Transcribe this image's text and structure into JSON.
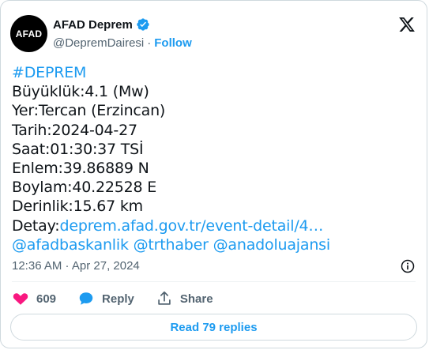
{
  "author": {
    "avatar_text": "AFAD",
    "name": "AFAD Deprem",
    "handle": "@DepremDairesi",
    "separator": "·",
    "follow_label": "Follow"
  },
  "tweet": {
    "hashtag": "#DEPREM",
    "lines": [
      "Büyüklük:4.1 (Mw)",
      "Yer:Tercan (Erzincan)",
      "Tarih:2024-04-27",
      "Saat:01:30:37 TSİ",
      "Enlem:39.86889 N",
      "Boylam:40.22528 E",
      "Derinlik:15.67 km"
    ],
    "detail_prefix": "Detay:",
    "detail_link": "deprem.afad.gov.tr/event-detail/4…",
    "mentions": [
      "@afadbaskanlik",
      "@trthaber",
      "@anadoluajansi"
    ]
  },
  "meta": {
    "timestamp": "12:36 AM · Apr 27, 2024"
  },
  "actions": {
    "like_count": "609",
    "reply_label": "Reply",
    "share_label": "Share"
  },
  "read_replies_label": "Read 79 replies",
  "colors": {
    "accent": "#1d9bf0",
    "like": "#f91880",
    "text": "#0f1419",
    "muted": "#536471"
  }
}
